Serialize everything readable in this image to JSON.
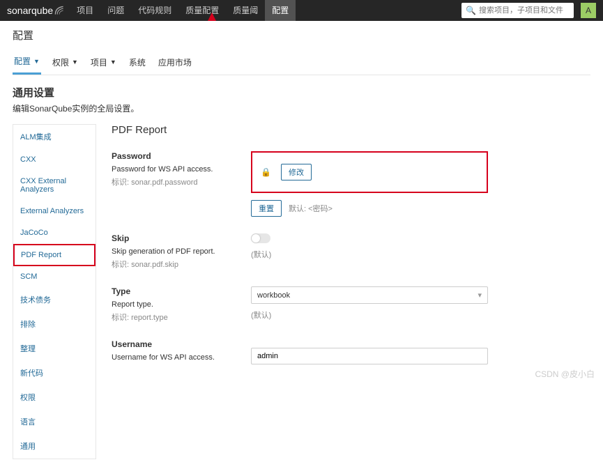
{
  "brand": "sonarqube",
  "topnav": [
    "项目",
    "问题",
    "代码规则",
    "质量配置",
    "质量阈",
    "配置"
  ],
  "topnav_active": 5,
  "search_placeholder": "搜索项目，子项目和文件",
  "avatar_letter": "A",
  "sub_title": "配置",
  "subtabs": [
    {
      "label": "配置",
      "caret": true,
      "active": true
    },
    {
      "label": "权限",
      "caret": true
    },
    {
      "label": "项目",
      "caret": true
    },
    {
      "label": "系统"
    },
    {
      "label": "应用市场"
    }
  ],
  "section": {
    "title": "通用设置",
    "desc": "编辑SonarQube实例的全局设置。"
  },
  "sidenav": [
    "ALM集成",
    "CXX",
    "CXX External Analyzers",
    "External Analyzers",
    "JaCoCo",
    "PDF Report",
    "SCM",
    "技术债务",
    "排除",
    "整理",
    "新代码",
    "权限",
    "语言",
    "通用"
  ],
  "sidenav_selected": 5,
  "content_title": "PDF Report",
  "settings": {
    "password": {
      "name": "Password",
      "desc": "Password for WS API access.",
      "key": "标识: sonar.pdf.password",
      "change_btn": "修改",
      "reset_btn": "重置",
      "default_text": "默认: <密码>"
    },
    "skip": {
      "name": "Skip",
      "desc": "Skip generation of PDF report.",
      "key": "标识: sonar.pdf.skip",
      "default_text": "(默认)"
    },
    "type": {
      "name": "Type",
      "desc": "Report type.",
      "key": "标识: report.type",
      "value": "workbook",
      "default_text": "(默认)"
    },
    "username": {
      "name": "Username",
      "desc": "Username for WS API access.",
      "value": "admin"
    }
  },
  "watermark": "CSDN @皮小白"
}
